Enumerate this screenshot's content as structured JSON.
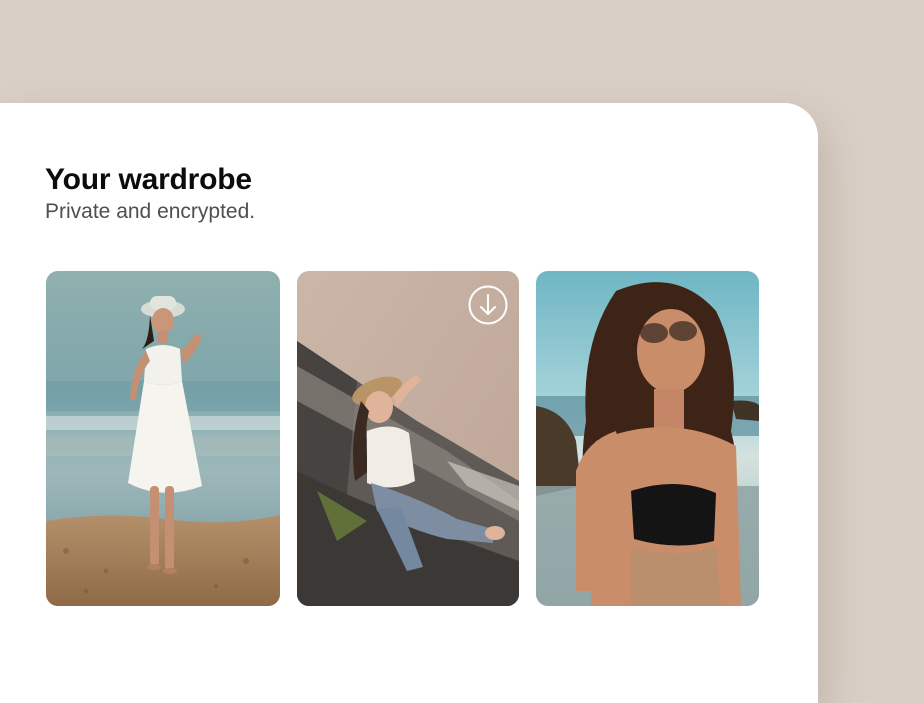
{
  "wardrobe": {
    "title": "Your wardrobe",
    "subtitle": "Private and encrypted."
  },
  "photos": [
    {
      "label": "photo-woman-white-dress-beach"
    },
    {
      "label": "photo-woman-hammock-hat",
      "action_icon": "download-icon"
    },
    {
      "label": "photo-woman-sunglasses-beach"
    }
  ],
  "colors": {
    "background": "#d9cfc6",
    "panel": "#ffffff",
    "title": "#0c0c0c",
    "subtitle": "#4f4f4f"
  }
}
